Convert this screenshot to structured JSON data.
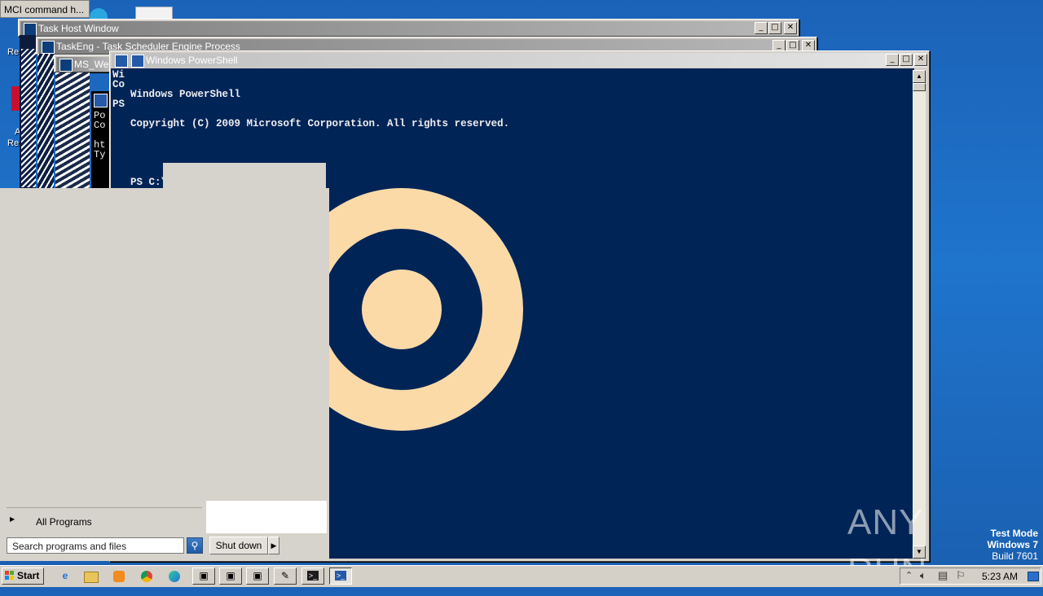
{
  "desktop": {
    "icons": [
      {
        "label": "Re"
      },
      {
        "label": "A"
      },
      {
        "label": "Re"
      }
    ]
  },
  "tooltip": {
    "text": "MCI command h..."
  },
  "windows": {
    "task_host": {
      "title": "Task Host Window"
    },
    "taskeng": {
      "title": "TaskEng - Task Scheduler Engine Process"
    },
    "ms_web": {
      "title": "MS_We"
    },
    "powershell_back": {
      "lines": [
        "Po",
        "Co",
        "",
        "ht",
        "Ty"
      ]
    },
    "powershell": {
      "title": "Windows PowerShell",
      "console_lines": [
        "Windows PowerShell",
        "Copyright (C) 2009 Microsoft Corporation. All rights reserved.",
        "",
        "PS C:\\Users\\admin>"
      ],
      "left_fragments": [
        "Wi",
        "Co",
        "",
        "PS"
      ]
    }
  },
  "start_menu": {
    "all_programs": "All Programs",
    "search_placeholder": "Search programs and files",
    "shutdown": "Shut down"
  },
  "taskbar": {
    "start": "Start",
    "clock": "5:23 AM"
  },
  "watermark": {
    "brand": "ANY RUN",
    "test_mode": "Test Mode",
    "os": "Windows 7",
    "build": "Build 7601"
  },
  "colors": {
    "console_bg": "#012456",
    "logo_ring": "#fcdaa8",
    "desktop": "#1f74cc"
  }
}
